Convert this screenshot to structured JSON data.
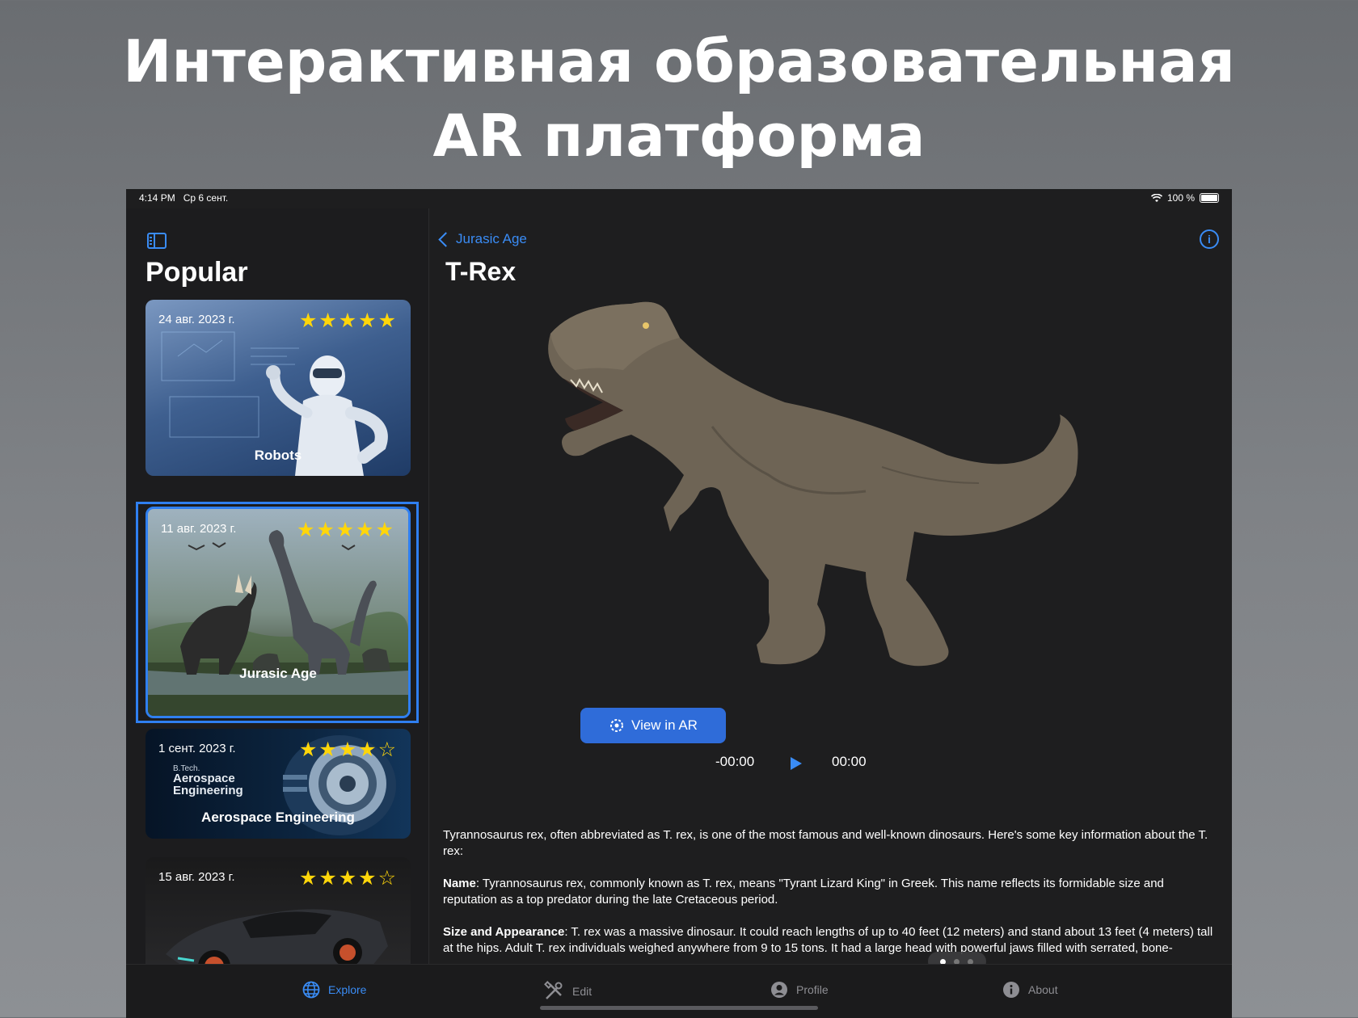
{
  "headline": {
    "line1": "Интерактивная образовательная",
    "line2": "AR платформа"
  },
  "status_bar": {
    "time": "4:14 PM",
    "date": "Ср 6 сент.",
    "battery": "100 %"
  },
  "sidebar": {
    "title": "Popular",
    "cards": [
      {
        "date": "24 авг. 2023 г.",
        "rating": 5,
        "stars": "★★★★★",
        "title": "Robots"
      },
      {
        "date": "11 авг. 2023 г.",
        "rating": 5,
        "stars": "★★★★★",
        "title": "Jurasic Age",
        "selected": true
      },
      {
        "date": "1 сент. 2023 г.",
        "rating": 4.5,
        "stars": "★★★★☆",
        "title": "Aerospace Engineering",
        "image_text_small": "B.Tech.",
        "image_text_big": "Aerospace Engineering"
      },
      {
        "date": "15 авг. 2023 г.",
        "rating": 4.5,
        "stars": "★★★★☆",
        "title": ""
      }
    ]
  },
  "main": {
    "back_label": "Jurasic Age",
    "title": "T-Rex",
    "ar_button": "View in AR",
    "time_elapsed": "-00:00",
    "time_total": "00:00",
    "description": {
      "intro": "Tyrannosaurus rex, often abbreviated as T. rex, is one of the most famous and well-known dinosaurs. Here's some key information about the T. rex:",
      "name_label": "Name",
      "name_text": ": Tyrannosaurus rex, commonly known as T. rex, means \"Tyrant Lizard King\" in Greek. This name reflects its formidable size and reputation as a top predator during the late Cretaceous period.",
      "size_label": "Size and Appearance",
      "size_text": ": T. rex was a massive dinosaur. It could reach lengths of up to 40 feet (12 meters) and stand about 13 feet (4 meters) tall at the hips. Adult T. rex individuals weighed anywhere from 9 to 15 tons. It had a large head with powerful jaws filled with serrated, bone-"
    }
  },
  "tab_bar": {
    "items": [
      {
        "label": "Explore",
        "icon": "globe-icon",
        "active": true
      },
      {
        "label": "Edit",
        "icon": "tools-icon",
        "active": false
      },
      {
        "label": "Profile",
        "icon": "person-icon",
        "active": false
      },
      {
        "label": "About",
        "icon": "info-icon",
        "active": false
      }
    ]
  },
  "colors": {
    "accent": "#3a8cf5",
    "star": "#ffd60a",
    "background": "#1e1e1f"
  }
}
